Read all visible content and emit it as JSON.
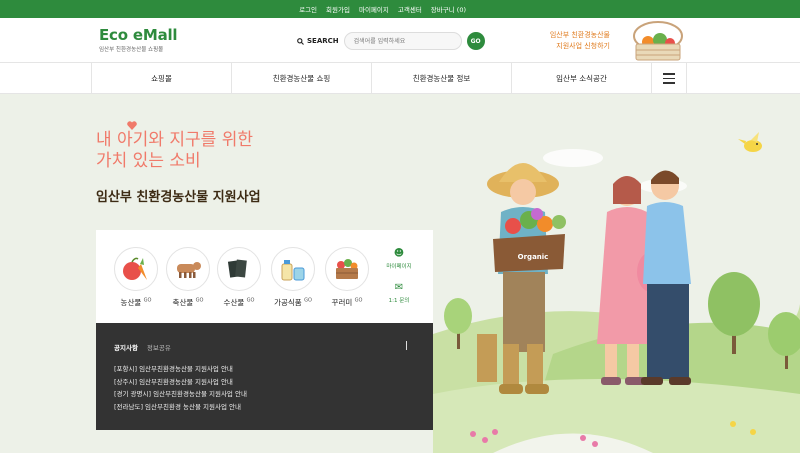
{
  "topbar": {
    "links": [
      "로그인",
      "회원가입",
      "마이페이지",
      "고객센터",
      "장바구니 (0)"
    ]
  },
  "logo": {
    "title": "Eco eMall",
    "subtitle": "임산부 친환경농산물 쇼핑몰"
  },
  "search": {
    "label": "SEARCH",
    "placeholder": "검색어를 입력하세요",
    "go_label": "GO"
  },
  "apply": {
    "line1": "임산부 친환경농산물",
    "line2": "지원사업 신청하기"
  },
  "nav": {
    "items": [
      "쇼핑몰",
      "친환경농산물 쇼핑",
      "친환경농산물 정보",
      "임산부 소식공간"
    ]
  },
  "hero": {
    "slogan_line1": "내 아기와 지구를 위한",
    "slogan_line2": "가치 있는 소비",
    "headline": "임산부 친환경농산물 지원사업",
    "box_label": "Organic"
  },
  "categories": [
    {
      "label": "농산물",
      "icon": "vegetables-icon"
    },
    {
      "label": "축산물",
      "icon": "cow-icon"
    },
    {
      "label": "수산물",
      "icon": "seaweed-icon"
    },
    {
      "label": "가공식품",
      "icon": "processed-food-icon"
    },
    {
      "label": "꾸러미",
      "icon": "basket-icon"
    }
  ],
  "side_links": {
    "mypage": "마이페이지",
    "inquiry": "1:1 문의"
  },
  "notice": {
    "tab_active": "공지사항",
    "tab_other": "정보공유",
    "items": [
      "[포항시] 임산부친환경농산물 지원사업 안내",
      "[상주시] 임산부친환경농산물 지원사업 안내",
      "[경기 광명시] 임산부친환경농산물 지원사업 안내",
      "[전라남도] 임산부친환경 농산물 지원사업 안내"
    ]
  },
  "colors": {
    "brand_green": "#2e8b3d",
    "slogan_pink": "#f07a6a",
    "apply_orange": "#e07b1e",
    "notice_bg": "#333333"
  }
}
